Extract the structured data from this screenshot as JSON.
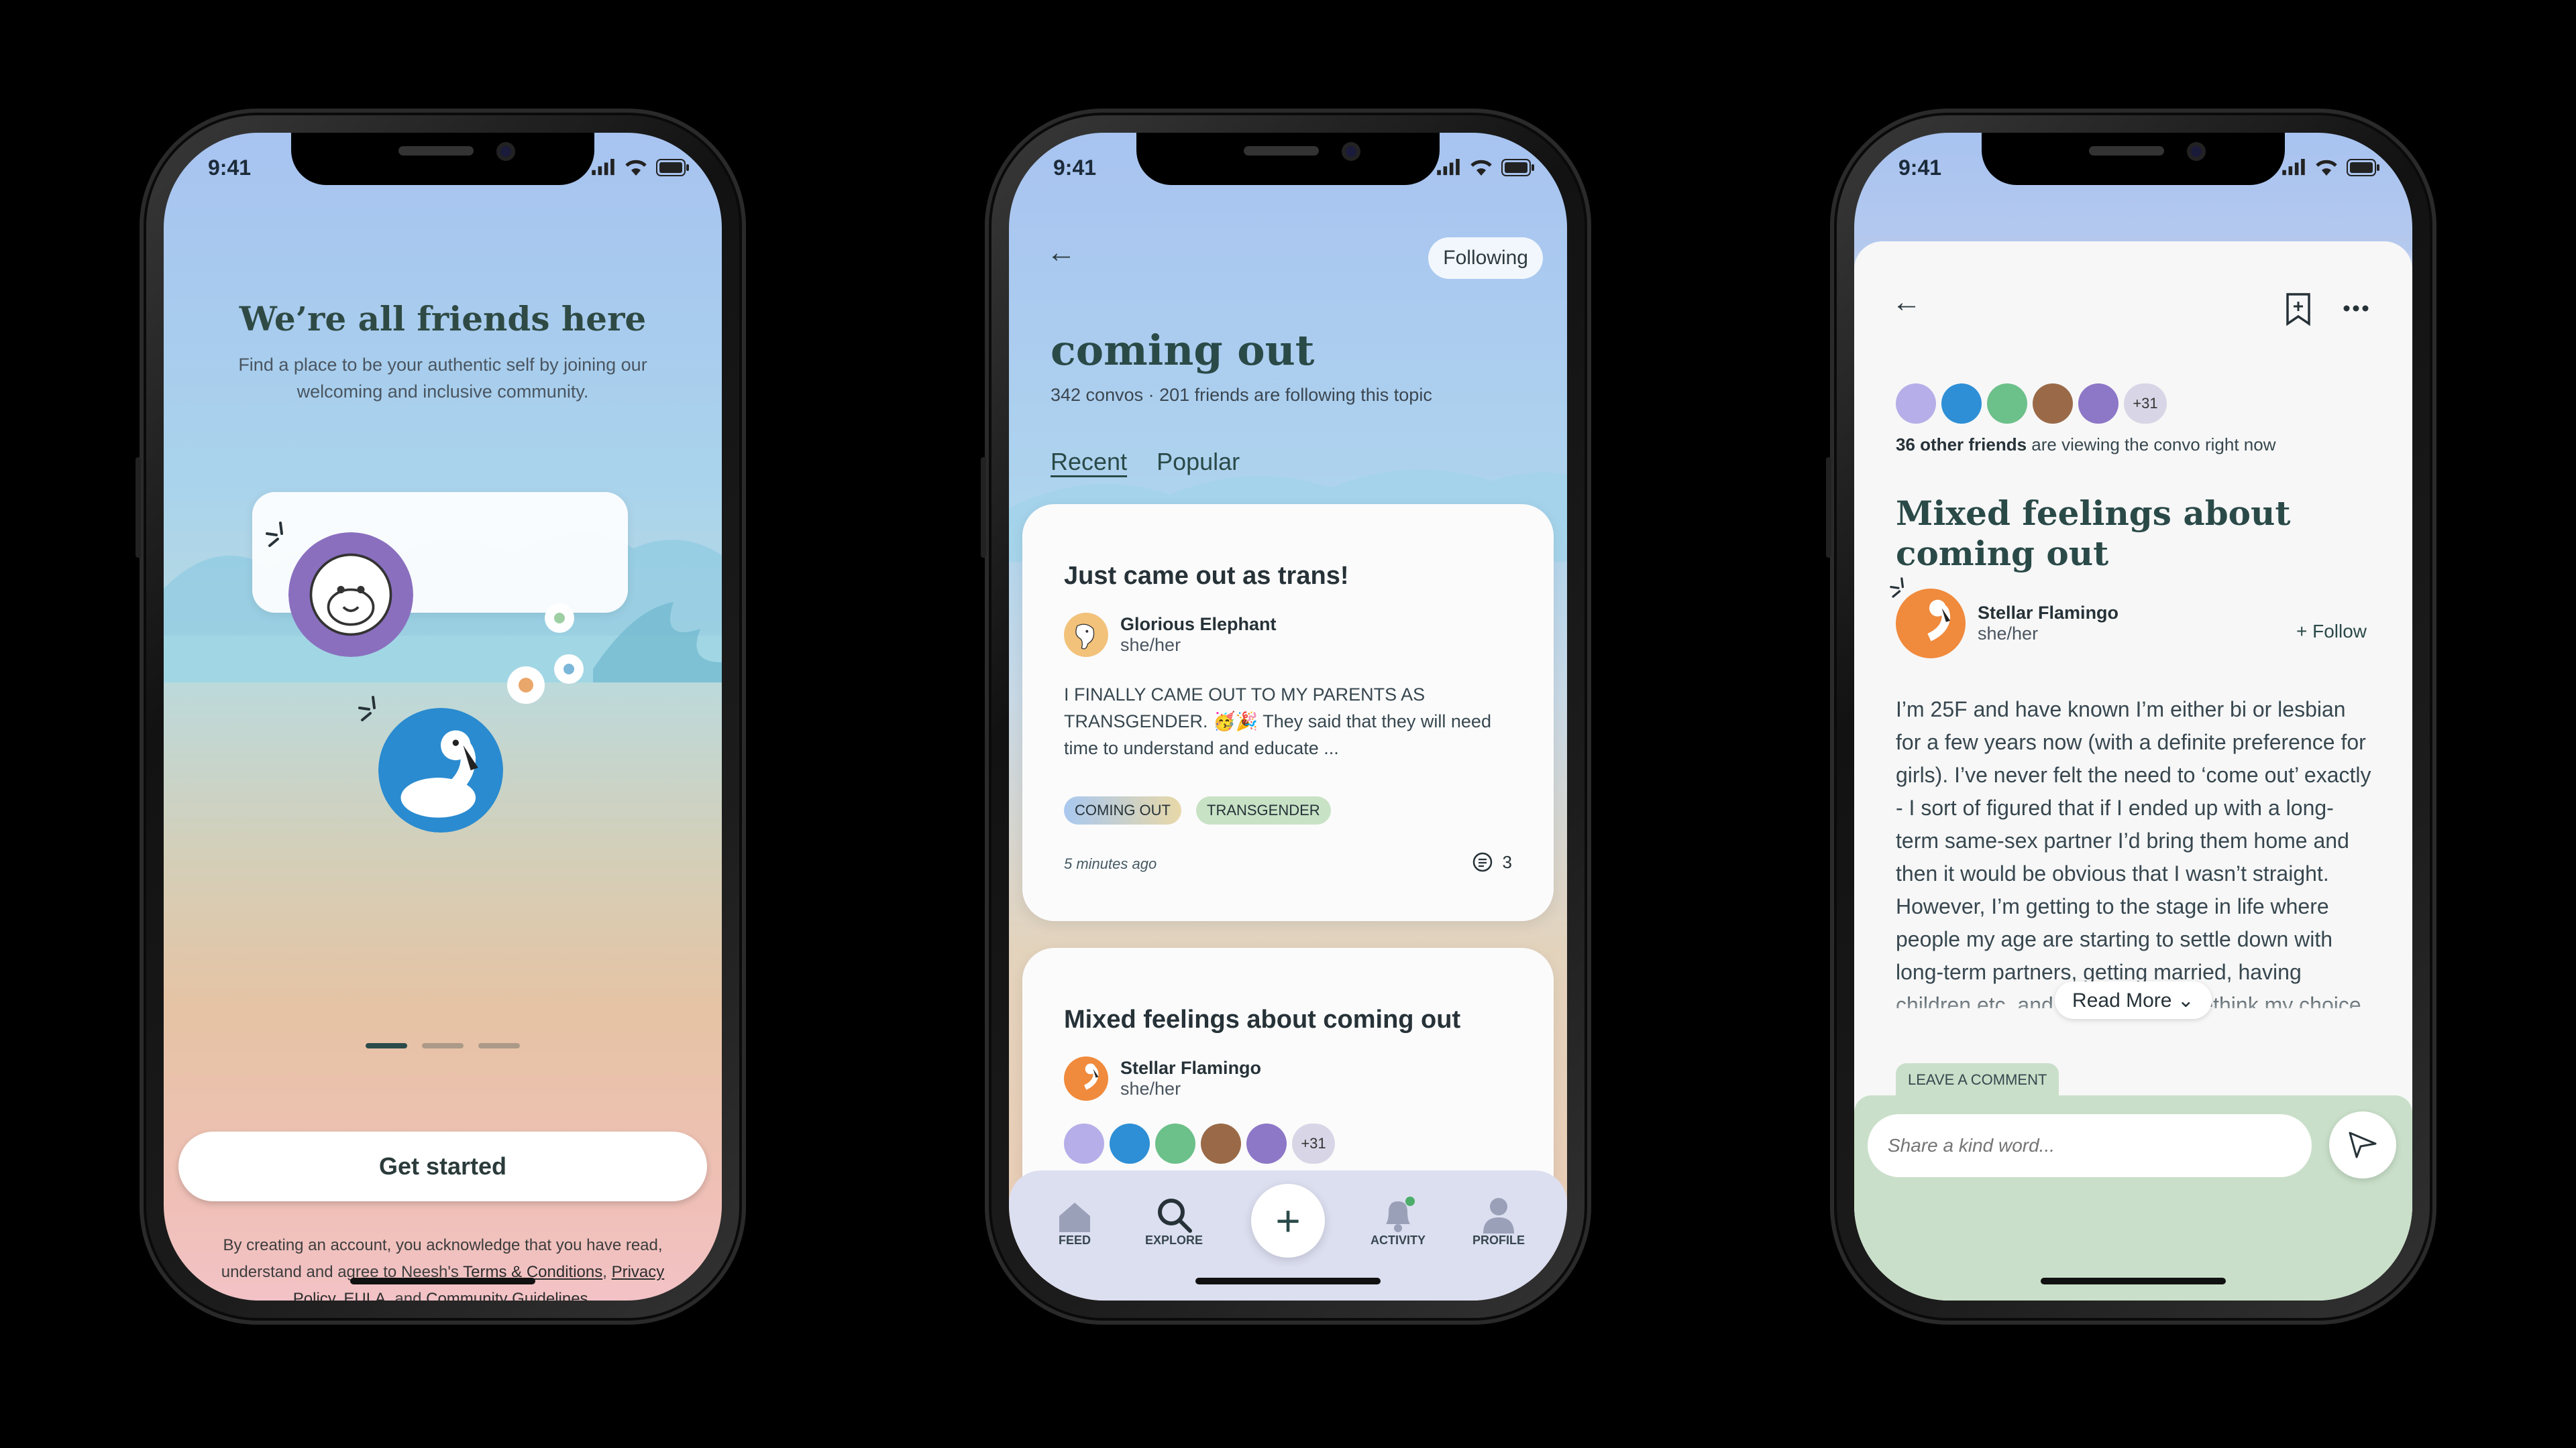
{
  "status": {
    "time": "9:41"
  },
  "onboarding": {
    "headline": "We’re all friends here",
    "subtitle": "Find a place to be your authentic self by joining our welcoming and inclusive community.",
    "cta": "Get started",
    "legal_prefix": "By creating an account, you acknowledge that you have read, understand and agree to Neesh's",
    "terms": "Terms & Conditions",
    "privacy": "Privacy Policy",
    "eula": "EULA",
    "and": "and",
    "community": "Community Guidelines"
  },
  "topic": {
    "following_label": "Following",
    "title": "coming out",
    "meta": "342 convos · 201 friends are following this topic",
    "tabs": [
      "Recent",
      "Popular"
    ],
    "posts": [
      {
        "title": "Just came out as trans!",
        "author": "Glorious Elephant",
        "pronouns": "she/her",
        "body": "I FINALLY CAME OUT TO MY PARENTS AS TRANSGENDER. 🥳🎉 They said that they will need time to understand and educate ...",
        "tags": [
          "COMING OUT",
          "TRANSGENDER"
        ],
        "time": "5 minutes ago",
        "comments": "3"
      },
      {
        "title": "Mixed feelings about coming out",
        "author": "Stellar Flamingo",
        "pronouns": "she/her",
        "extra_count": "+31"
      }
    ],
    "nav": [
      "FEED",
      "EXPLORE",
      "ACTIVITY",
      "PROFILE"
    ]
  },
  "post": {
    "extra_count": "+31",
    "viewing_bold": "36 other friends",
    "viewing_rest": " are viewing the convo right now",
    "title": "Mixed feelings about coming out",
    "author": "Stellar Flamingo",
    "pronouns": "she/her",
    "follow": "+ Follow",
    "body": "I’m 25F and have known I’m either bi or lesbian for a few years now (with a definite preference for girls). I’ve never felt the need to ‘come out’ exactly - I sort of figured that if I ended up with a long-term same-sex partner I’d bring them home and then it would be obvious that I wasn’t straight. However, I’m getting to the stage in life where people my age are starting to settle down with long-term partners, getting married, having children etc. and I’m starting to rethink my choice not to come out. Various friends and family members have ... up with men",
    "read_more": "Read More",
    "leave_comment": "LEAVE A COMMENT",
    "comment_placeholder": "Share a kind word..."
  }
}
